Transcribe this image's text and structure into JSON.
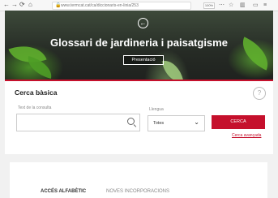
{
  "browser": {
    "url": "www.termcat.cat/ca/diccionaris-en-linia/253",
    "zoom": "100%",
    "back_icon": "back-arrow-icon",
    "forward_icon": "forward-arrow-icon",
    "reload_icon": "reload-icon",
    "home_icon": "home-icon"
  },
  "hero": {
    "title": "Glossari de jardineria i paisatgisme",
    "button_label": "Presentació"
  },
  "search": {
    "title": "Cerca bàsica",
    "query_label": "Text de la consulta",
    "query_value": "",
    "language_label": "Llengua",
    "language_selected": "Totes",
    "search_button": "CERCA",
    "advanced_link": "Cerca avançada",
    "help_icon": "question-icon"
  },
  "tabs": [
    {
      "label": "ACCÉS ALFABÈTIC",
      "active": true
    },
    {
      "label": "NOVES INCORPORACIONS",
      "active": false
    }
  ],
  "colors": {
    "accent": "#c5102c",
    "hero_dark": "#262b25"
  }
}
